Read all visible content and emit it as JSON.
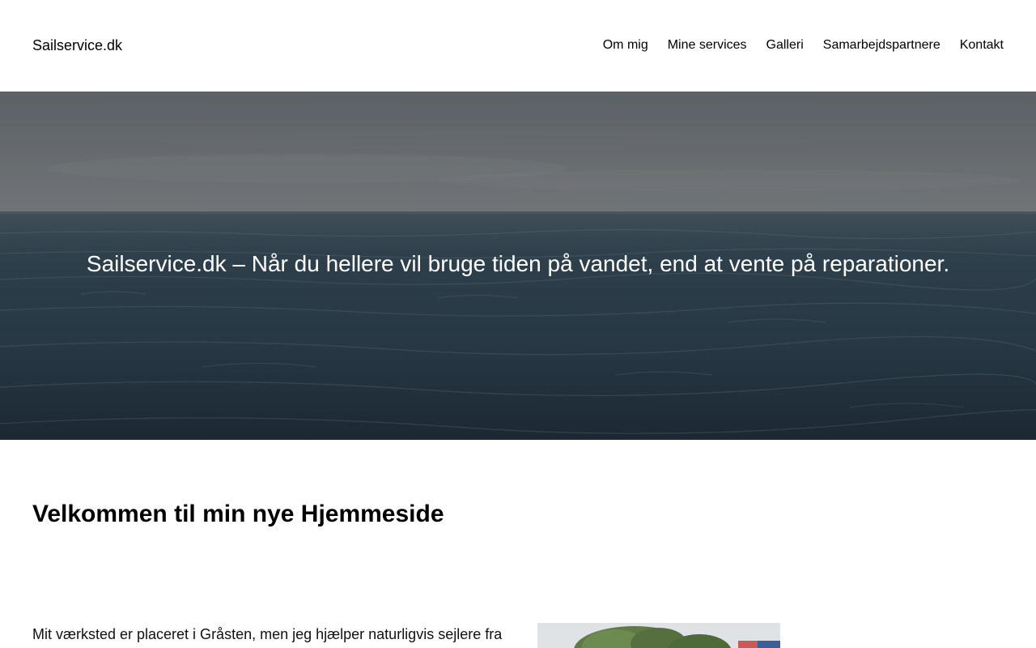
{
  "header": {
    "site_title": "Sailservice.dk",
    "nav": [
      {
        "label": "Om mig"
      },
      {
        "label": "Mine services"
      },
      {
        "label": "Galleri"
      },
      {
        "label": "Samarbejdspartnere"
      },
      {
        "label": "Kontakt"
      }
    ]
  },
  "hero": {
    "heading": "Sailservice.dk – Når du hellere vil bruge tiden på vandet, end at vente på reparationer."
  },
  "main": {
    "welcome_heading": "Velkommen til min nye Hjemmeside",
    "intro_text": "Mit værksted er placeret i Gråsten, men jeg hjælper naturligvis sejlere fra"
  },
  "colors": {
    "text": "#000000",
    "background": "#ffffff",
    "hero_text": "#ffffff",
    "sea_dark": "#26353f",
    "sky": "#7d8182"
  }
}
